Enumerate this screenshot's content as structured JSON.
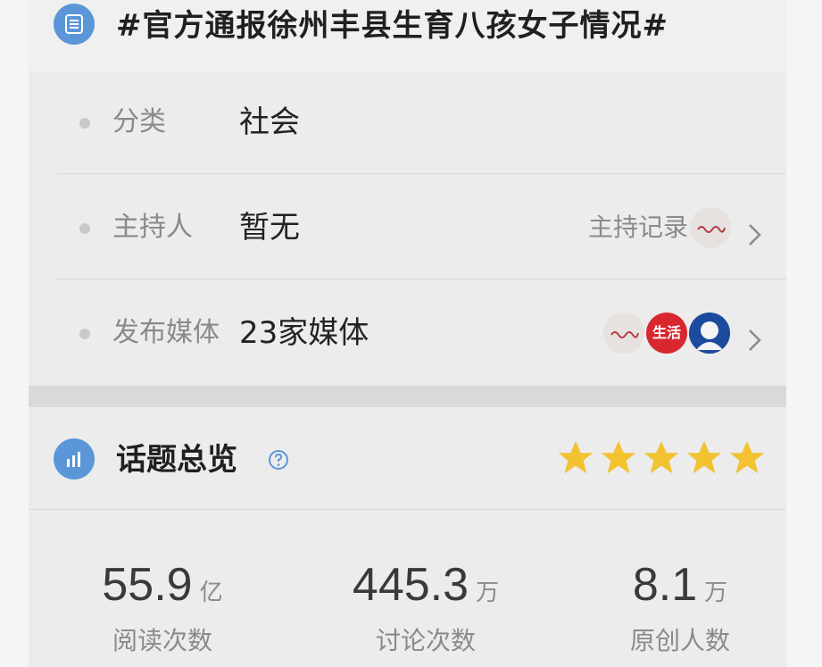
{
  "header": {
    "icon": "list-document-icon",
    "title": "#官方通报徐州丰县生育八孩女子情况#"
  },
  "rows": [
    {
      "label": "分类",
      "value": "社会"
    },
    {
      "label": "主持人",
      "value": "暂无",
      "action_label": "主持记录",
      "avatar": "gm-daily-avatar"
    },
    {
      "label": "发布媒体",
      "value": "23家媒体",
      "avatars": [
        "gm-daily-avatar",
        "shenghuo-avatar",
        "person-avatar"
      ],
      "life_text": "生活"
    }
  ],
  "overview": {
    "icon": "bar-chart-icon",
    "title": "话题总览",
    "help_icon": "question-circle-icon",
    "stars": 5,
    "star_color": "#f2c230",
    "stats": [
      {
        "number": "55.9",
        "unit": "亿",
        "caption": "阅读次数"
      },
      {
        "number": "445.3",
        "unit": "万",
        "caption": "讨论次数"
      },
      {
        "number": "8.1",
        "unit": "万",
        "caption": "原创人数"
      }
    ]
  }
}
